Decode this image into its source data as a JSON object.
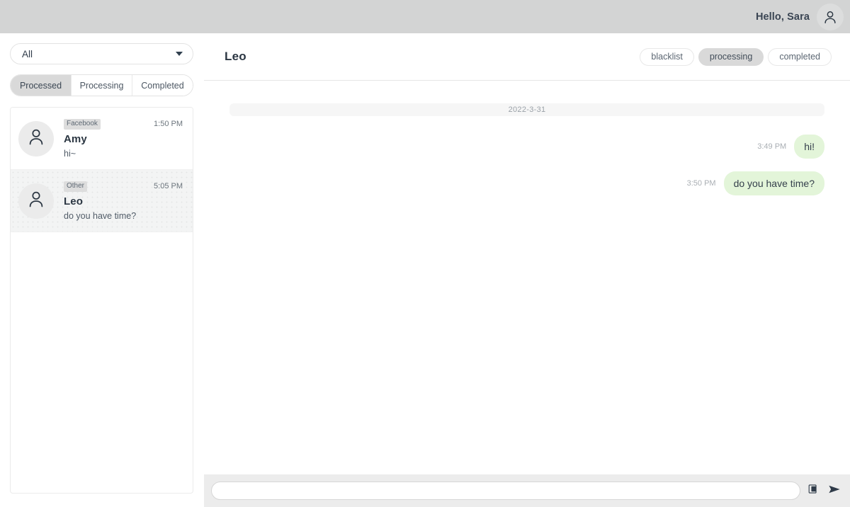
{
  "topbar": {
    "greeting": "Hello, Sara",
    "avatar_icon": "user-avatar-icon"
  },
  "sidebar": {
    "filter": {
      "value": "All",
      "caret_icon": "chevron-down-icon"
    },
    "segments": [
      {
        "label": "Processed",
        "active": true
      },
      {
        "label": "Processing",
        "active": false
      },
      {
        "label": "Completed",
        "active": false
      }
    ],
    "conversations": [
      {
        "tag": "Facebook",
        "name": "Amy",
        "preview": "hi~",
        "time": "1:50 PM",
        "avatar_icon": "user-avatar-icon",
        "selected": false
      },
      {
        "tag": "Other",
        "name": "Leo",
        "preview": "do you have time?",
        "time": "5:05 PM",
        "avatar_icon": "user-avatar-icon",
        "selected": true
      }
    ]
  },
  "chat": {
    "title": "Leo",
    "actions": [
      {
        "label": "blacklist",
        "active": false
      },
      {
        "label": "processing",
        "active": true
      },
      {
        "label": "completed",
        "active": false
      }
    ],
    "date_divider": "2022-3-31",
    "messages": [
      {
        "text": "hi!",
        "time": "3:49 PM",
        "outgoing": true
      },
      {
        "text": "do you have time?",
        "time": "3:50 PM",
        "outgoing": true
      }
    ],
    "composer": {
      "value": "",
      "placeholder": "",
      "image_icon": "image-attachment-icon",
      "send_icon": "send-icon"
    }
  },
  "colors": {
    "topbar": "#d3d4d4",
    "accent_bubble": "#e3f5d9",
    "active_segment": "#d9d9d9",
    "selected_row": "#f3f4f4"
  }
}
